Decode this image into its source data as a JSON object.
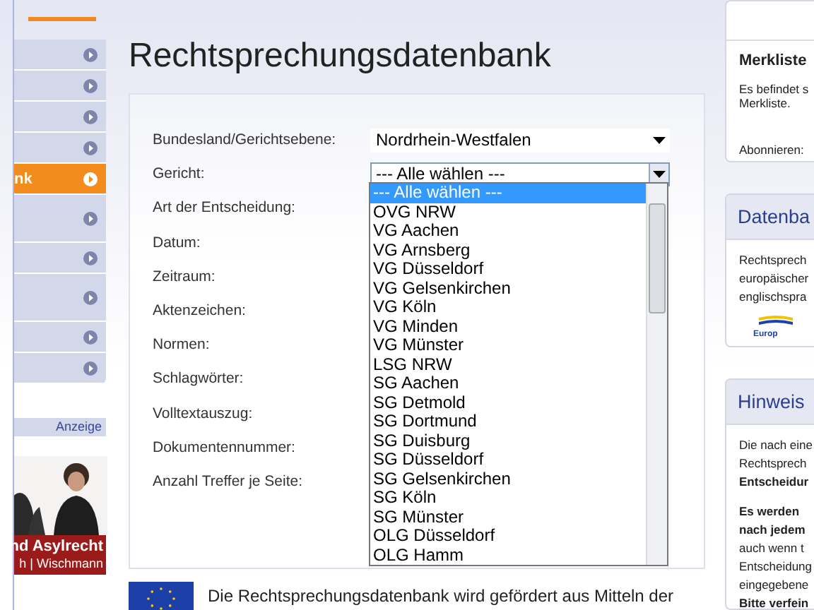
{
  "sidebar": {
    "items": [
      {
        "selected": false,
        "kind": "short"
      },
      {
        "selected": false,
        "kind": "short"
      },
      {
        "selected": false,
        "kind": "short"
      },
      {
        "selected": false,
        "kind": "short"
      },
      {
        "label": "nk",
        "selected": true,
        "kind": "short"
      },
      {
        "selected": false,
        "kind": "tall"
      },
      {
        "selected": false,
        "kind": "short"
      },
      {
        "selected": false,
        "kind": "tall"
      },
      {
        "selected": false,
        "kind": "short"
      },
      {
        "selected": false,
        "kind": "short"
      }
    ],
    "ad": {
      "label": "Anzeige",
      "banner": [
        "nd Asylrecht",
        "h | Wischmann"
      ]
    }
  },
  "main": {
    "title": "Rechtsprechungsdatenbank",
    "form": {
      "rows": [
        {
          "label": "Bundesland/Gerichtsebene:",
          "kind": "select",
          "value": "Nordrhein-Westfalen"
        },
        {
          "label": "Gericht:",
          "kind": "open-select",
          "value": "--- Alle wählen ---"
        },
        {
          "label": "Art der Entscheidung:",
          "kind": "label"
        },
        {
          "label": "Datum:",
          "kind": "label"
        },
        {
          "label": "Zeitraum:",
          "kind": "label"
        },
        {
          "label": "Aktenzeichen:",
          "kind": "label"
        },
        {
          "label": "Normen:",
          "kind": "label"
        },
        {
          "label": "Schlagwörter:",
          "kind": "label"
        },
        {
          "label": "Volltextauszug:",
          "kind": "label"
        },
        {
          "label": "Dokumentennummer:",
          "kind": "label"
        },
        {
          "label": "Anzahl Treffer je Seite:",
          "kind": "label"
        }
      ],
      "dropdown": [
        {
          "label": "--- Alle wählen ---",
          "selected": true
        },
        {
          "label": "OVG NRW",
          "selected": false
        },
        {
          "label": "VG Aachen",
          "selected": false
        },
        {
          "label": "VG Arnsberg",
          "selected": false
        },
        {
          "label": "VG Düsseldorf",
          "selected": false
        },
        {
          "label": "VG Gelsenkirchen",
          "selected": false
        },
        {
          "label": "VG Köln",
          "selected": false
        },
        {
          "label": "VG Minden",
          "selected": false
        },
        {
          "label": "VG Münster",
          "selected": false
        },
        {
          "label": "LSG NRW",
          "selected": false
        },
        {
          "label": "SG Aachen",
          "selected": false
        },
        {
          "label": "SG Detmold",
          "selected": false
        },
        {
          "label": "SG Dortmund",
          "selected": false
        },
        {
          "label": "SG Duisburg",
          "selected": false
        },
        {
          "label": "SG Düsseldorf",
          "selected": false
        },
        {
          "label": "SG Gelsenkirchen",
          "selected": false
        },
        {
          "label": "SG Köln",
          "selected": false
        },
        {
          "label": "SG Münster",
          "selected": false
        },
        {
          "label": "OLG Düsseldorf",
          "selected": false
        },
        {
          "label": "OLG Hamm",
          "selected": false
        }
      ]
    },
    "funding": "Die Rechtsprechungsdatenbank wird gefördert aus Mitteln der"
  },
  "right": {
    "merkliste": {
      "title": "Merkliste",
      "text": [
        "Es befindet s",
        "Merkliste."
      ],
      "subscribe": "Abonnieren:"
    },
    "datenbank": {
      "title": "Datenba",
      "text": [
        "Rechtsprech",
        "europäischer",
        "englischspra"
      ],
      "logo_text": "Europ"
    },
    "hinweise": {
      "title": "Hinweis",
      "text": [
        {
          "text": "Die nach eine",
          "bold": false
        },
        {
          "text": "Rechtsprech",
          "bold": false
        },
        {
          "text": "Entscheidur",
          "bold": true
        }
      ],
      "text2": [
        {
          "text": "Es werden",
          "bold": true
        },
        {
          "text": "nach jedem",
          "bold": true
        },
        {
          "text": "auch wenn t",
          "bold": false
        },
        {
          "text": "Entscheidung",
          "bold": false
        },
        {
          "text": "eingegebene",
          "bold": false
        },
        {
          "text": "Bitte verfein",
          "bold": true
        }
      ]
    }
  }
}
